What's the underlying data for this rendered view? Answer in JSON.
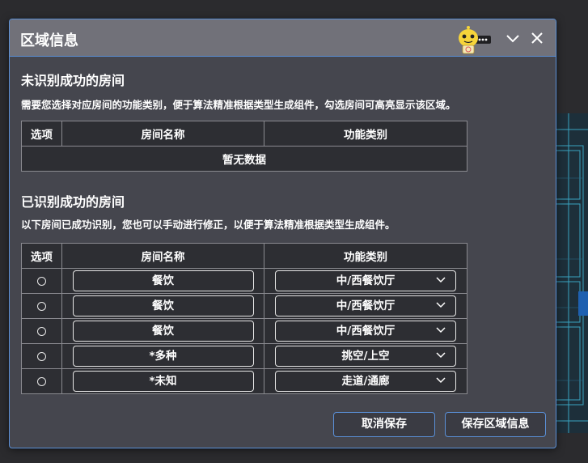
{
  "dialog": {
    "title": "区域信息",
    "minimize_icon": "chevron-down-icon",
    "close_icon": "close-icon",
    "mascot_icon": "robot-mascot-icon"
  },
  "unrecognized": {
    "title": "未识别成功的房间",
    "description": "需要您选择对应房间的功能类别，便于算法精准根据类型生成组件，勾选房间可高亮显示该区域。",
    "headers": [
      "选项",
      "房间名称",
      "功能类别"
    ],
    "empty_text": "暂无数据"
  },
  "recognized": {
    "title": "已识别成功的房间",
    "description": "以下房间已成功识别，您也可以手动进行修正，以便于算法精准根据类型生成组件。",
    "headers": [
      "选项",
      "房间名称",
      "功能类别"
    ],
    "rows": [
      {
        "name": "餐饮",
        "category": "中/西餐饮厅"
      },
      {
        "name": "餐饮",
        "category": "中/西餐饮厅"
      },
      {
        "name": "餐饮",
        "category": "中/西餐饮厅"
      },
      {
        "name": "*多种",
        "category": "挑空/上空"
      },
      {
        "name": "*未知",
        "category": "走道/通廊"
      }
    ]
  },
  "footer": {
    "cancel_label": "取消保存",
    "save_label": "保存区域信息"
  },
  "colors": {
    "accent": "#5a8fd6",
    "dialog_bg": "#45464e",
    "titlebar_bg": "#717179",
    "table_bg": "#2d2e33",
    "cad_line": "#3fb8d8"
  }
}
